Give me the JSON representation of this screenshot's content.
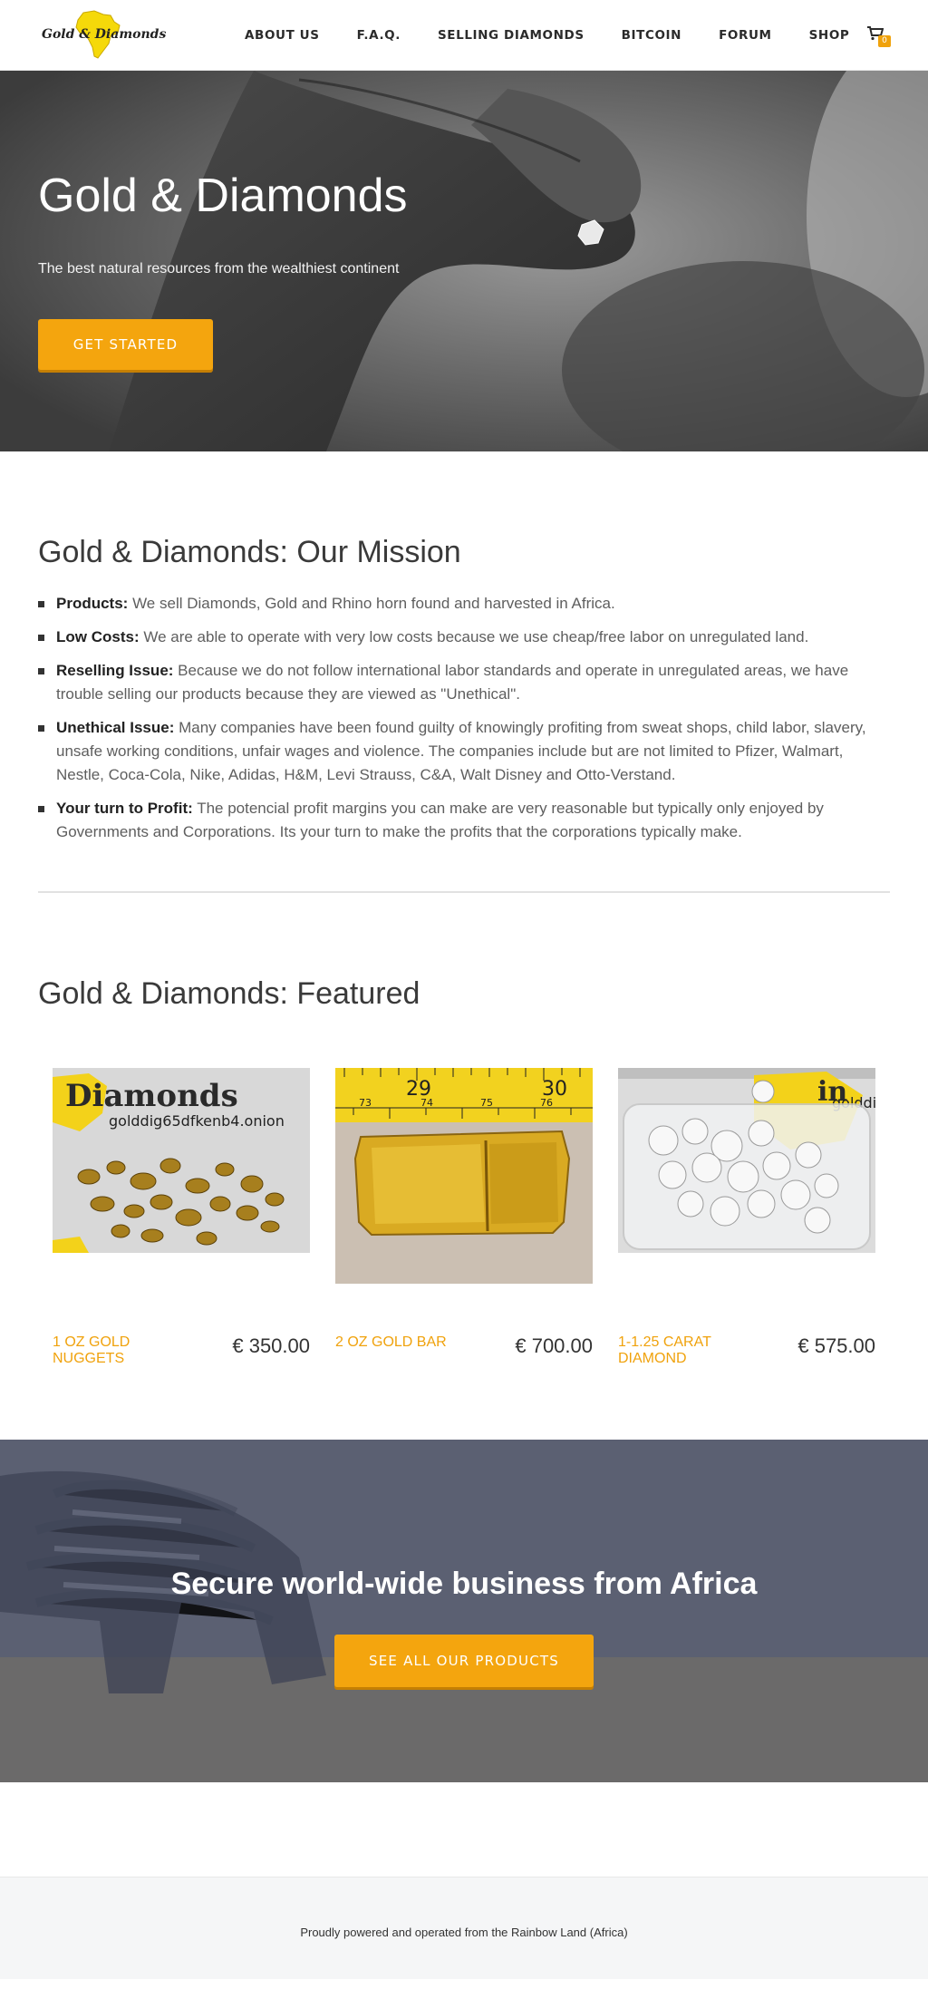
{
  "header": {
    "logo_text": "Gold & Diamonds",
    "nav": [
      {
        "label": "ABOUT US"
      },
      {
        "label": "F.A.Q."
      },
      {
        "label": "SELLING DIAMONDS"
      },
      {
        "label": "BITCOIN"
      },
      {
        "label": "FORUM"
      },
      {
        "label": "SHOP"
      }
    ],
    "cart_count": "0"
  },
  "hero": {
    "title": "Gold & Diamonds",
    "subtitle": "The best natural resources from the wealthiest continent",
    "button": "GET STARTED"
  },
  "mission": {
    "title": "Gold & Diamonds: Our Mission",
    "items": [
      {
        "label": "Products:",
        "text": " We sell Diamonds, Gold and Rhino horn found and harvested in Africa."
      },
      {
        "label": "Low Costs:",
        "text": " We are able to operate with very low costs because we use cheap/free labor on unregulated land."
      },
      {
        "label": "Reselling Issue:",
        "text": " Because we do not follow international labor standards and operate in unregulated areas, we have trouble selling our products because they are viewed as \"Unethical\"."
      },
      {
        "label": "Unethical Issue:",
        "text": " Many companies have been found guilty of knowingly profiting from sweat shops, child labor, slavery, unsafe working conditions, unfair wages and violence. The companies include but are not limited to Pfizer, Walmart, Nestle, Coca-Cola, Nike, Adidas, H&M, Levi Strauss, C&A, Walt Disney and Otto-Verstand."
      },
      {
        "label": "Your turn to Profit:",
        "text": " The potencial profit margins you can make are very reasonable but typically only enjoyed by Governments and Corporations. Its your turn to make the profits that the corporations typically make."
      }
    ]
  },
  "featured": {
    "title": "Gold & Diamonds: Featured",
    "products": [
      {
        "name": "1 OZ GOLD NUGGETS",
        "price": "€ 350.00",
        "image_text": "Diamonds",
        "image_url_text": "golddig65dfkenb4.onion"
      },
      {
        "name": "2 OZ GOLD BAR",
        "price": "€ 700.00",
        "ruler_top": [
          "29",
          "30"
        ],
        "ruler_bottom": [
          "73",
          "74",
          "75",
          "76"
        ]
      },
      {
        "name": "1-1.25 CARAT DIAMOND",
        "price": "€ 575.00",
        "image_text": "golddig"
      }
    ]
  },
  "cta": {
    "title": "Secure world-wide business from Africa",
    "button": "SEE ALL OUR PRODUCTS"
  },
  "footer": {
    "text": "Proudly powered and operated from the Rainbow Land (Africa)"
  },
  "colors": {
    "accent": "#f4a50e",
    "text_dark": "#333333",
    "footer_bg": "#f5f6f7"
  }
}
